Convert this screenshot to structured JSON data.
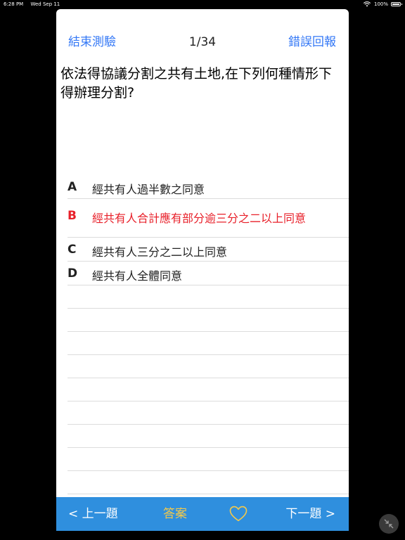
{
  "status_bar": {
    "time": "6:28 PM",
    "date": "Wed Sep 11",
    "battery": "100%"
  },
  "nav": {
    "end_test_label": "結束測驗",
    "counter": "1/34",
    "report_label": "錯誤回報"
  },
  "question": {
    "text": "依法得協議分割之共有土地,在下列何種情形下得辦理分割?"
  },
  "options": [
    {
      "letter": "A",
      "text": "經共有人過半數之同意"
    },
    {
      "letter": "B",
      "text": "經共有人合計應有部分逾三分之二以上同意"
    },
    {
      "letter": "C",
      "text": "經共有人三分之二以上同意"
    },
    {
      "letter": "D",
      "text": "經共有人全體同意"
    }
  ],
  "toolbar": {
    "prev_label": "< 上一題",
    "answer_label": "答案",
    "next_label": "下一題 >",
    "favorite_icon": "heart-outline-icon"
  },
  "colors": {
    "accent": "#3478f6",
    "correct_option": "#e8202a",
    "toolbar_bg": "#2f8fde",
    "answer_label": "#f3c94b"
  }
}
